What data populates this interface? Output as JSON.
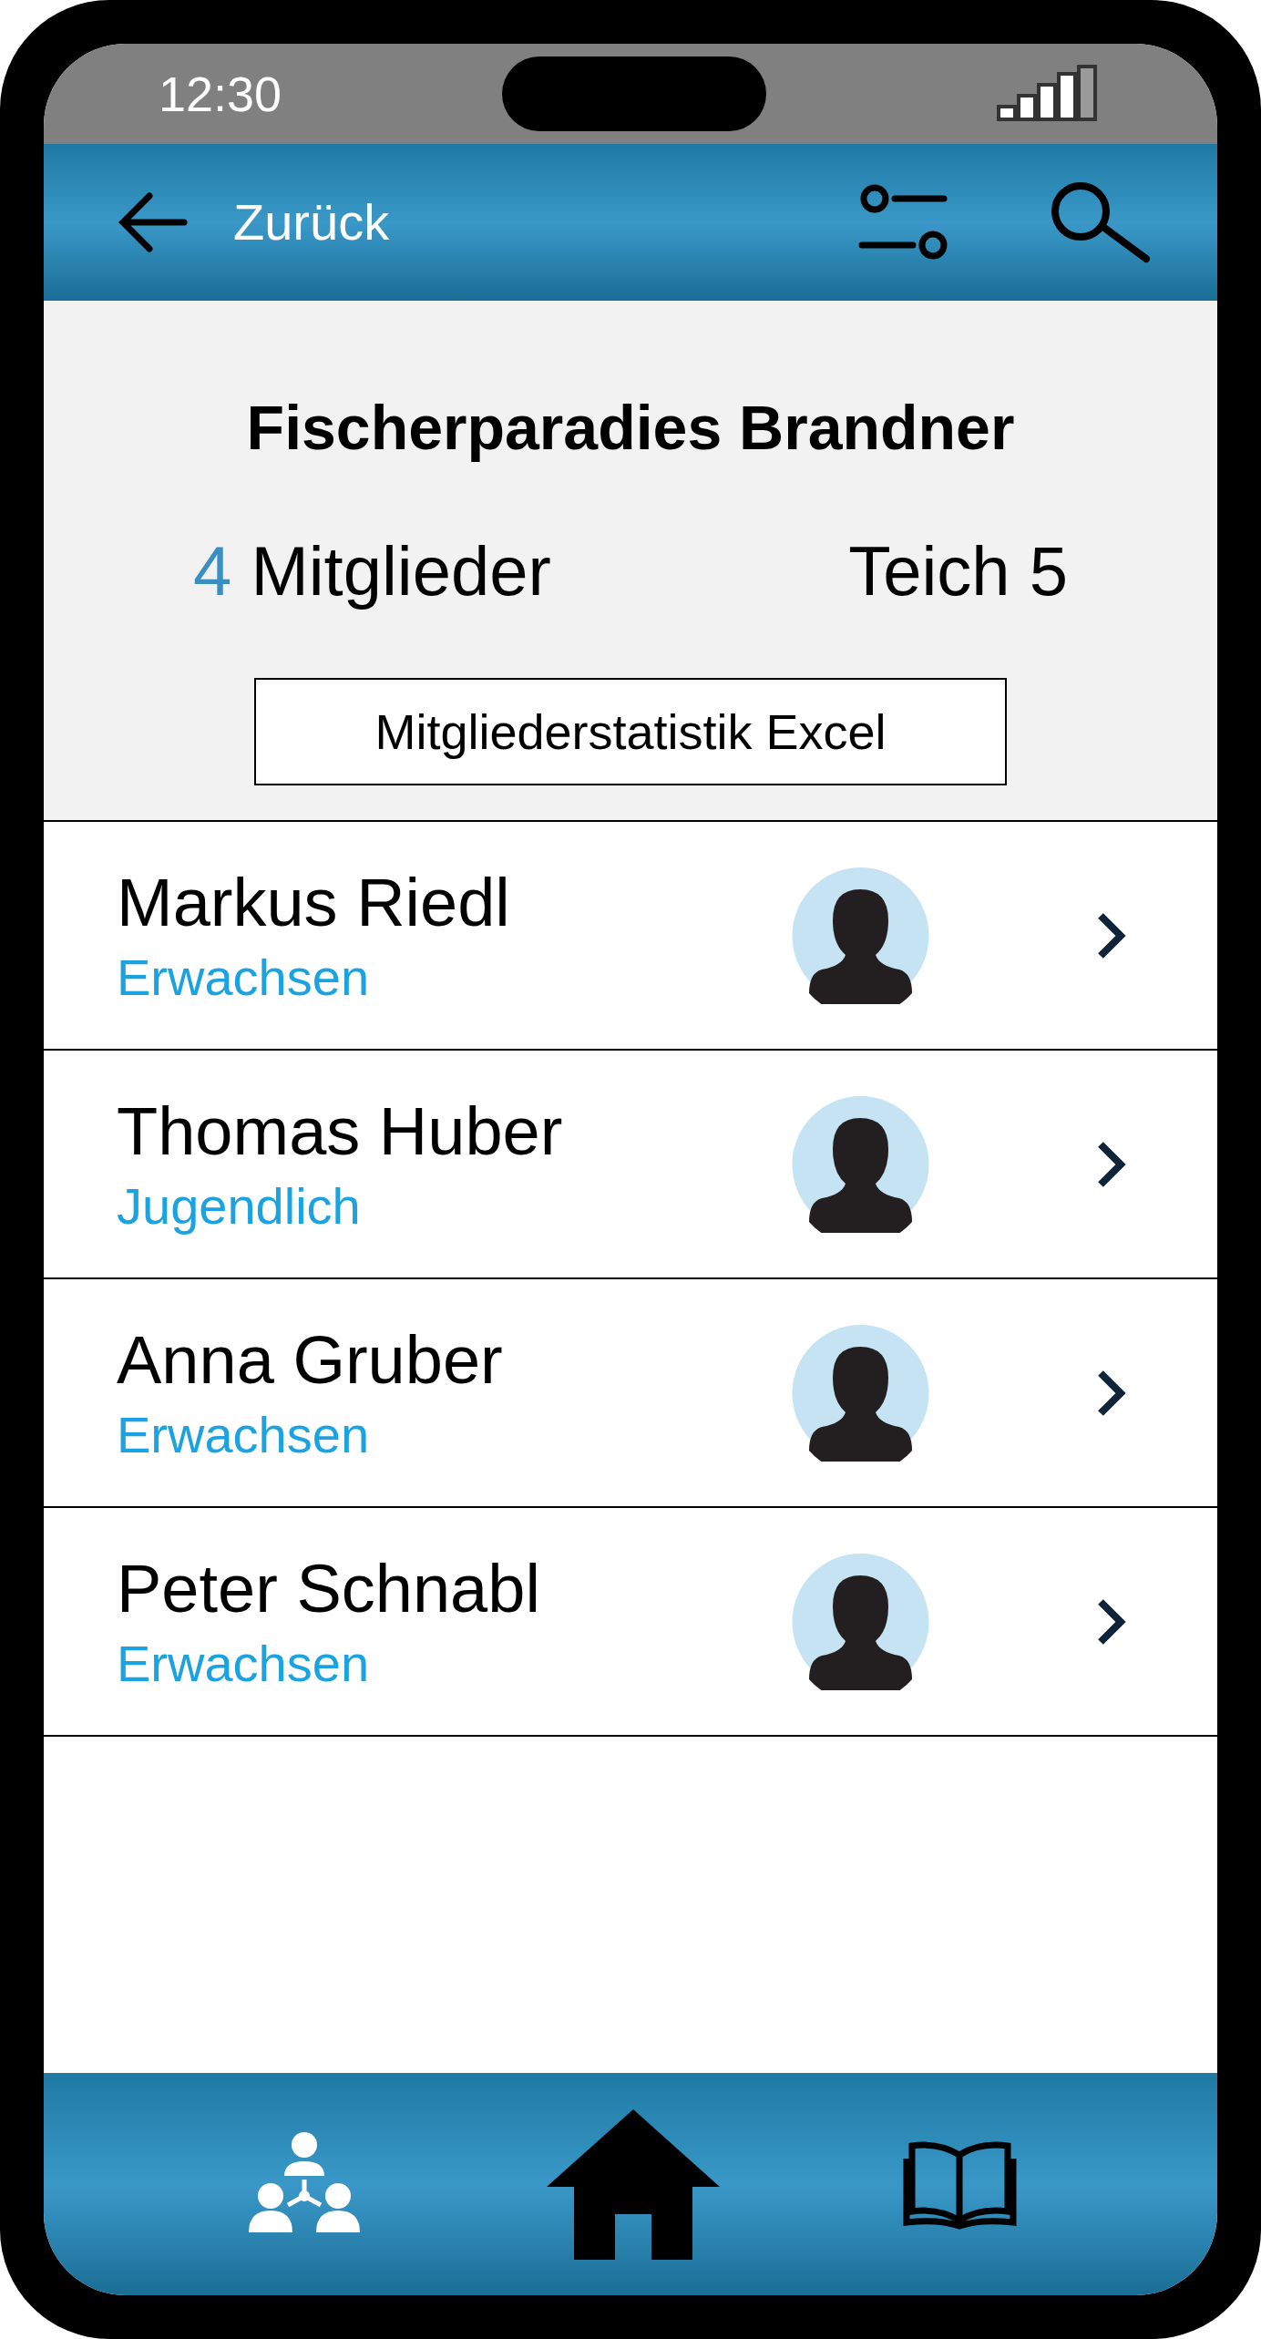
{
  "status_bar": {
    "time": "12:30"
  },
  "header": {
    "back_label": "Zurück"
  },
  "club": {
    "title": "Fischerparadies Brandner",
    "member_count": "4",
    "member_label": "Mitglieder",
    "pond": "Teich 5",
    "export_button": "Mitgliederstatistik Excel"
  },
  "members": [
    {
      "name": "Markus Riedl",
      "category": "Erwachsen"
    },
    {
      "name": "Thomas Huber",
      "category": "Jugendlich"
    },
    {
      "name": "Anna Gruber",
      "category": "Erwachsen"
    },
    {
      "name": "Peter Schnabl",
      "category": "Erwachsen"
    }
  ],
  "nav": [
    {
      "kind": "members",
      "selected": false
    },
    {
      "kind": "home",
      "selected": true
    },
    {
      "kind": "book",
      "selected": false
    }
  ]
}
